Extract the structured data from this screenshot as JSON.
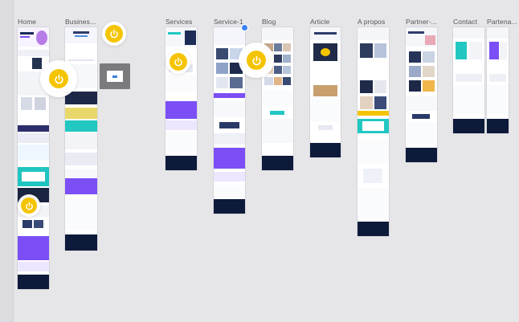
{
  "canvas": {
    "background": "#e6e6e9"
  },
  "frames": [
    {
      "label": "Home"
    },
    {
      "label": "Busines..."
    },
    {
      "label": "Services"
    },
    {
      "label": "Service-1"
    },
    {
      "label": "Blog"
    },
    {
      "label": "Article"
    },
    {
      "label": "A propos"
    },
    {
      "label": "Partner-..."
    },
    {
      "label": "Contact"
    },
    {
      "label": "Partena..."
    }
  ],
  "colors": {
    "accent_yellow": "#f5c400",
    "purple": "#7b4ff5",
    "cyan": "#22c7c2",
    "navy": "#0e1a3a",
    "popup_gray": "#7b7b7e"
  },
  "cursor_badge_icon": "power-icon"
}
